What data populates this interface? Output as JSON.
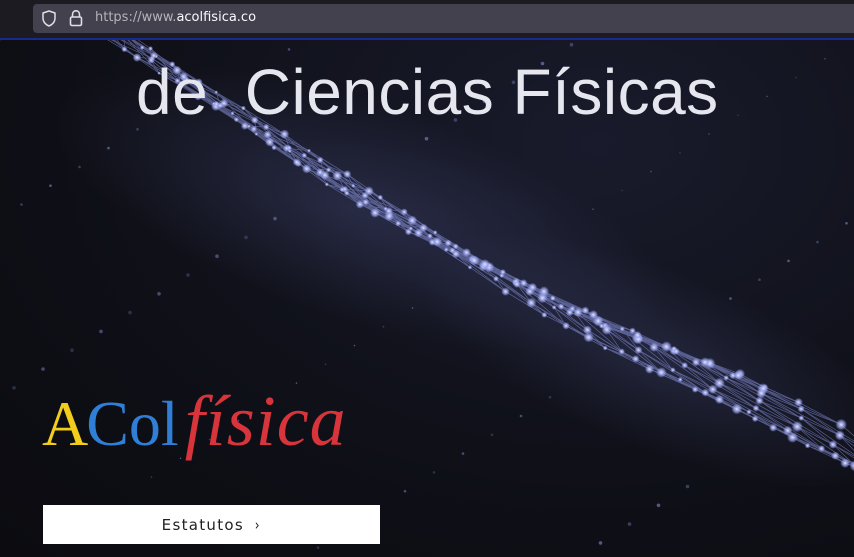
{
  "browser": {
    "url_scheme": "https://www.",
    "url_domain": "acolfisica.co",
    "icons": [
      "shield-icon",
      "lock-icon"
    ]
  },
  "hero": {
    "title": "de  Ciencias Físicas",
    "logo": {
      "part_a": "A",
      "part_col": "Col",
      "part_fisica": "física",
      "colors": {
        "a": "#f2cd1b",
        "col": "#2f7fd6",
        "fisica": "#d8343b"
      }
    },
    "button": {
      "label": "Estatutos",
      "chevron": "›"
    },
    "background": "network-mesh-image"
  }
}
